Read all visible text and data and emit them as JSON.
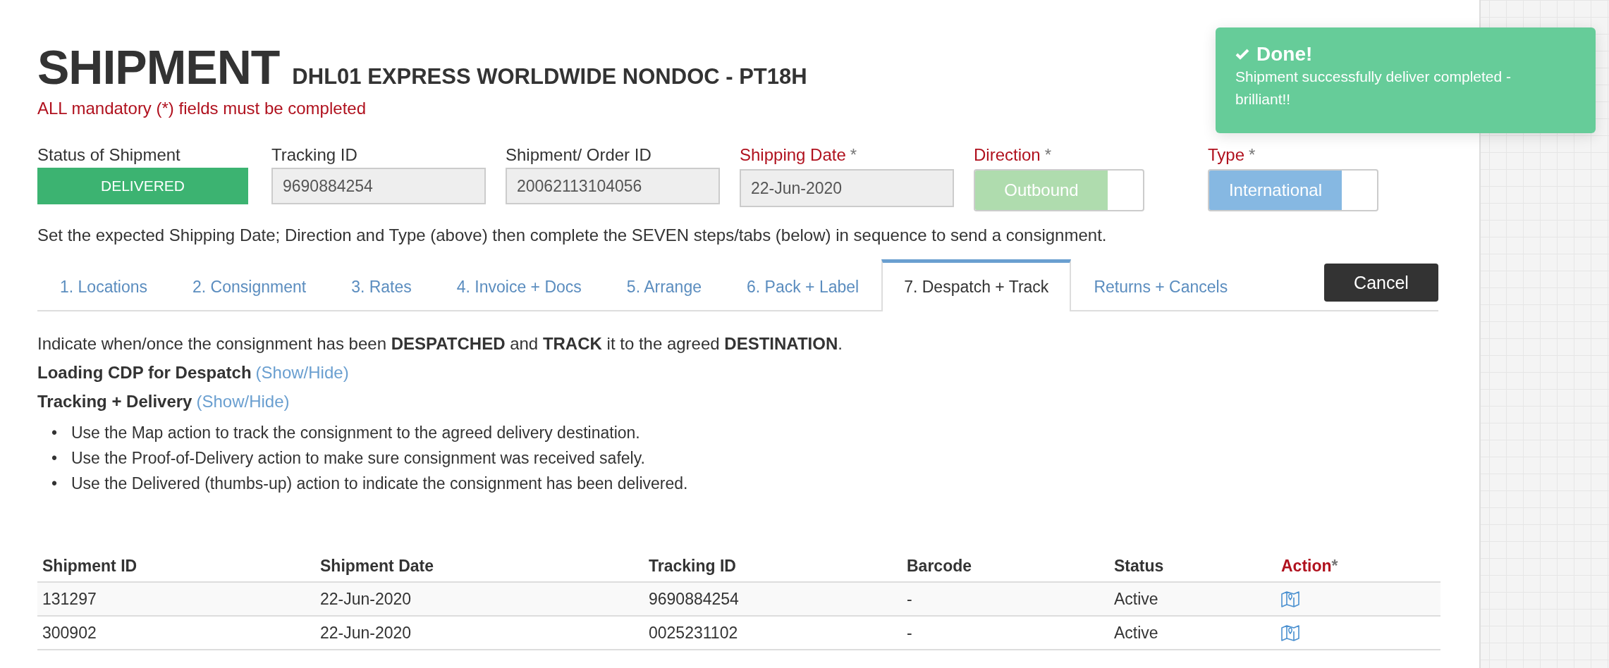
{
  "header": {
    "title": "SHIPMENT",
    "subtitle": "DHL01 EXPRESS WORLDWIDE NONDOC - PT18H",
    "warning": "ALL mandatory (*) fields must be completed"
  },
  "fields": [
    {
      "kind": "status",
      "label": "Status of Shipment",
      "value": "DELIVERED"
    },
    {
      "kind": "text",
      "label": "Tracking ID",
      "value": "9690884254"
    },
    {
      "kind": "text",
      "label": "Shipment/ Order ID",
      "value": "20062113104056"
    },
    {
      "kind": "text",
      "label": "Shipping Date",
      "mark": "*",
      "value": "22-Jun-2020"
    },
    {
      "kind": "toggle",
      "label": "Direction",
      "mark": "*",
      "value": "Outbound",
      "on": true,
      "color": "#afdcae"
    },
    {
      "kind": "toggle",
      "label": "Type",
      "mark": "*",
      "value": "International",
      "on": true,
      "color": "#86b8e2"
    }
  ],
  "instructions": "Set the expected Shipping Date; Direction and Type (above) then complete the SEVEN steps/tabs (below) in sequence to send a consignment.",
  "tabs": [
    {
      "label": "1. Locations",
      "selected": false
    },
    {
      "label": "2. Consignment",
      "selected": false
    },
    {
      "label": "3. Rates",
      "selected": false
    },
    {
      "label": "4. Invoice + Docs",
      "selected": false
    },
    {
      "label": "5. Arrange",
      "selected": false
    },
    {
      "label": "6. Pack + Label",
      "selected": false
    },
    {
      "label": "7. Despatch + Track",
      "selected": true
    },
    {
      "label": "Returns + Cancels",
      "selected": false
    }
  ],
  "cancel_button": "Cancel",
  "intro": "Indicate when/once the consignment has been **DESPATCHED** and **TRACK** it to the agreed **DESTINATION**.",
  "sections": [
    {
      "title": "Loading CDP for Despatch",
      "link": "(Show/Hide)"
    },
    {
      "title": "Tracking + Delivery",
      "link": "(Show/Hide)"
    }
  ],
  "bullets": [
    {
      "marker": "•",
      "text": "Use the Map action to track the consignment to the agreed delivery destination."
    },
    {
      "marker": "•",
      "text": "Use the Proof-of-Delivery action to make sure consignment was received safely."
    },
    {
      "marker": "•",
      "text": "Use the Delivered (thumbs-up) action to indicate the consignment has been delivered."
    }
  ],
  "table": {
    "columns": [
      {
        "label": "Shipment ID"
      },
      {
        "label": "Shipment Date"
      },
      {
        "label": "Tracking ID"
      },
      {
        "label": "Barcode"
      },
      {
        "label": "Status"
      },
      {
        "label": "Action",
        "mark": "*"
      }
    ],
    "rows": [
      {
        "cells": [
          "131297",
          "22-Jun-2020",
          "9690884254",
          "-",
          "Active"
        ]
      },
      {
        "cells": [
          "300902",
          "22-Jun-2020",
          "0025231102",
          "-",
          "Active"
        ]
      }
    ]
  },
  "toast": {
    "title": "Done!",
    "message": "Shipment successfully deliver completed - brilliant!!"
  }
}
